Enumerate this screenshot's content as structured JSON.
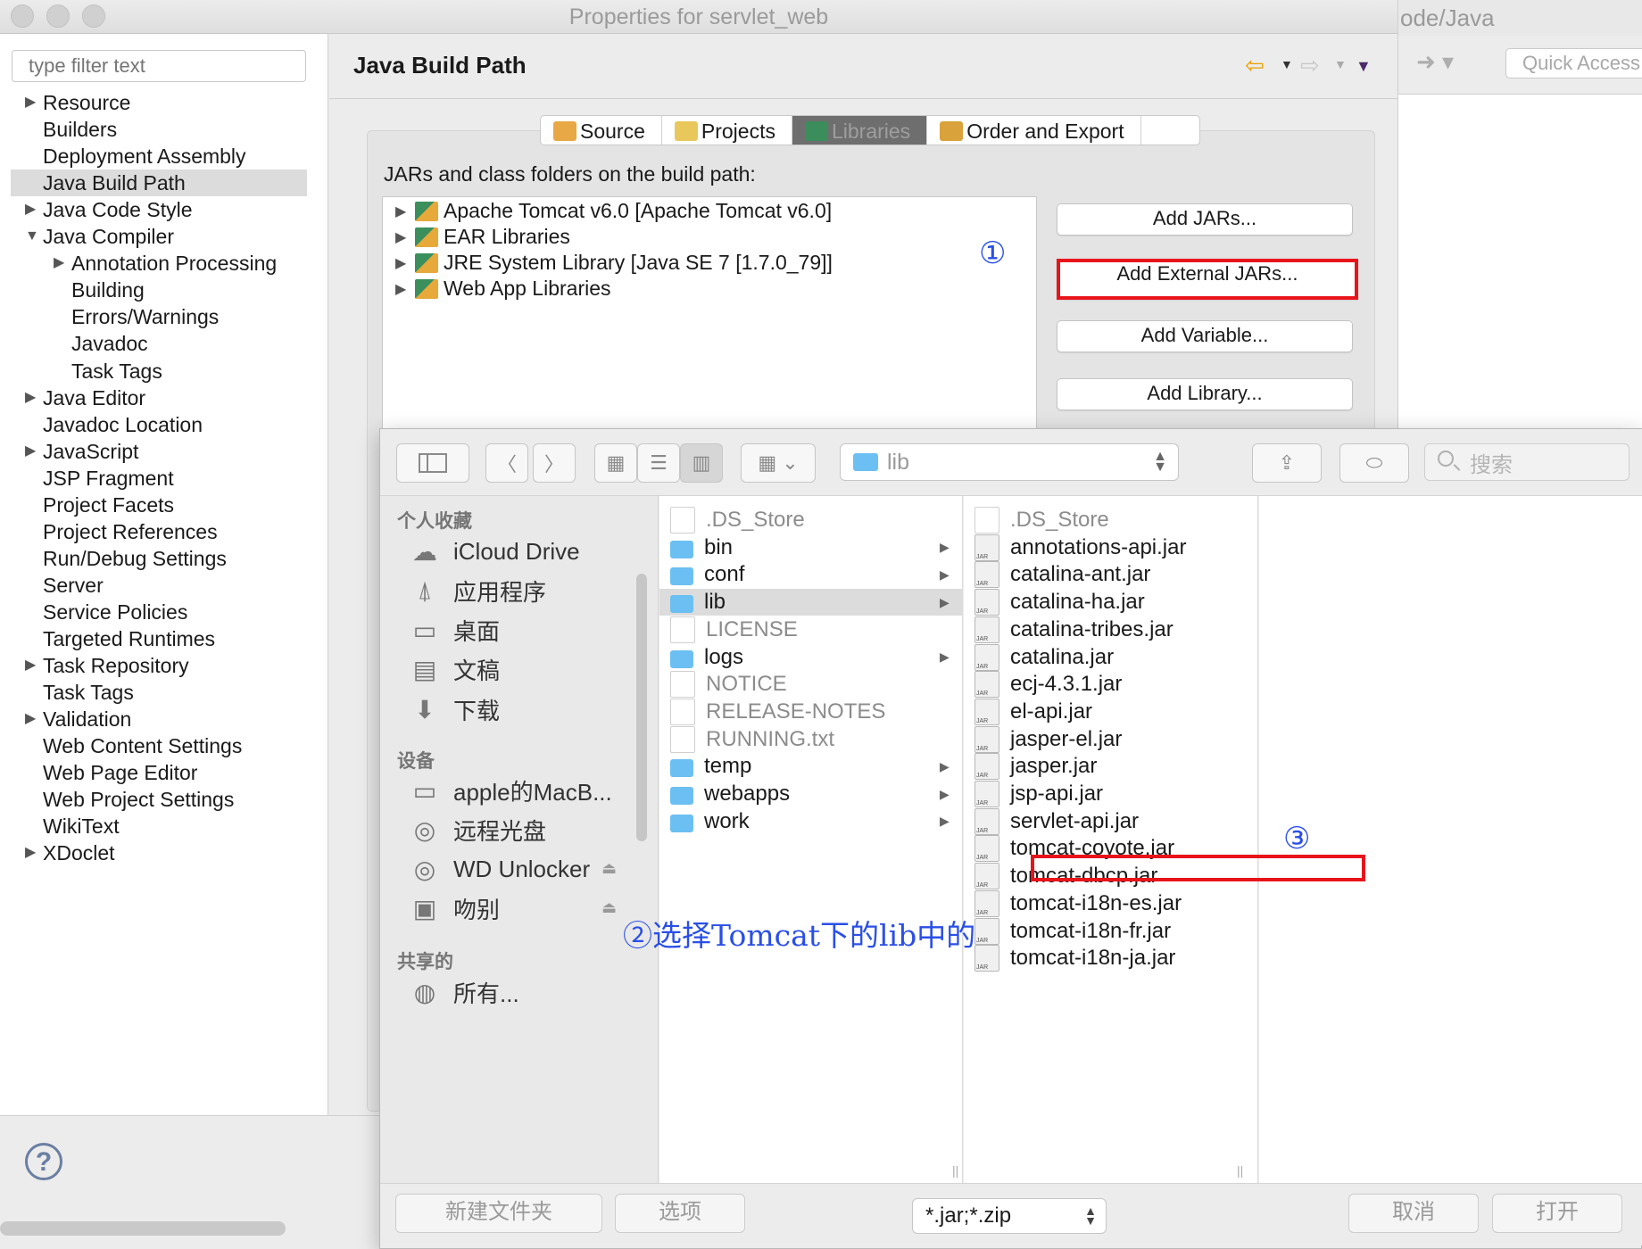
{
  "background_window": {
    "title_fragment": "ode/Java",
    "quick_access_placeholder": "Quick Access"
  },
  "window": {
    "title": "Properties for servlet_web"
  },
  "nav": {
    "filter_placeholder": "type filter text",
    "items": [
      {
        "label": "Resource",
        "expandable": true
      },
      {
        "label": "Builders"
      },
      {
        "label": "Deployment Assembly"
      },
      {
        "label": "Java Build Path",
        "selected": true
      },
      {
        "label": "Java Code Style",
        "expandable": true
      },
      {
        "label": "Java Compiler",
        "expanded": true
      },
      {
        "label": "Annotation Processing",
        "expandable": true,
        "indent": 1
      },
      {
        "label": "Building",
        "indent": 1
      },
      {
        "label": "Errors/Warnings",
        "indent": 1
      },
      {
        "label": "Javadoc",
        "indent": 1
      },
      {
        "label": "Task Tags",
        "indent": 1
      },
      {
        "label": "Java Editor",
        "expandable": true
      },
      {
        "label": "Javadoc Location"
      },
      {
        "label": "JavaScript",
        "expandable": true
      },
      {
        "label": "JSP Fragment"
      },
      {
        "label": "Project Facets"
      },
      {
        "label": "Project References"
      },
      {
        "label": "Run/Debug Settings"
      },
      {
        "label": "Server"
      },
      {
        "label": "Service Policies"
      },
      {
        "label": "Targeted Runtimes"
      },
      {
        "label": "Task Repository",
        "expandable": true
      },
      {
        "label": "Task Tags"
      },
      {
        "label": "Validation",
        "expandable": true
      },
      {
        "label": "Web Content Settings"
      },
      {
        "label": "Web Page Editor"
      },
      {
        "label": "Web Project Settings"
      },
      {
        "label": "WikiText"
      },
      {
        "label": "XDoclet",
        "expandable": true
      }
    ]
  },
  "page": {
    "title": "Java Build Path",
    "tabs": [
      {
        "label": "Source"
      },
      {
        "label": "Projects"
      },
      {
        "label": "Libraries",
        "active": true
      },
      {
        "label": "Order and Export"
      }
    ],
    "libs_label": "JARs and class folders on the build path:",
    "libraries": [
      "Apache Tomcat v6.0 [Apache Tomcat v6.0]",
      "EAR Libraries",
      "JRE System Library [Java SE 7 [1.7.0_79]]",
      "Web App Libraries"
    ],
    "buttons": {
      "add_jars": "Add JARs...",
      "add_external_jars": "Add External JARs...",
      "add_variable": "Add Variable...",
      "add_library": "Add Library..."
    }
  },
  "annotations": {
    "step1": "①",
    "step2": "②选择Tomcat下的lib中的",
    "step3": "③"
  },
  "file_dialog": {
    "path": "lib",
    "search_placeholder": "搜索",
    "sidebar": {
      "favorites_header": "个人收藏",
      "favorites": [
        {
          "label": "iCloud Drive",
          "icon": "cloud-icon"
        },
        {
          "label": "应用程序",
          "icon": "applications-icon"
        },
        {
          "label": "桌面",
          "icon": "desktop-icon"
        },
        {
          "label": "文稿",
          "icon": "documents-icon"
        },
        {
          "label": "下载",
          "icon": "downloads-icon"
        }
      ],
      "devices_header": "设备",
      "devices": [
        {
          "label": "apple的MacB...",
          "icon": "laptop-icon"
        },
        {
          "label": "远程光盘",
          "icon": "disc-icon"
        },
        {
          "label": "WD Unlocker",
          "icon": "disc-icon"
        },
        {
          "label": "吻别",
          "icon": "drive-icon"
        }
      ],
      "shared_header": "共享的",
      "shared": [
        {
          "label": "所有...",
          "icon": "network-icon"
        }
      ]
    },
    "column1": [
      {
        "name": ".DS_Store",
        "type": "file",
        "dim": true
      },
      {
        "name": "bin",
        "type": "folder"
      },
      {
        "name": "conf",
        "type": "folder"
      },
      {
        "name": "lib",
        "type": "folder",
        "selected": true
      },
      {
        "name": "LICENSE",
        "type": "file",
        "dim": true
      },
      {
        "name": "logs",
        "type": "folder"
      },
      {
        "name": "NOTICE",
        "type": "file",
        "dim": true
      },
      {
        "name": "RELEASE-NOTES",
        "type": "file",
        "dim": true
      },
      {
        "name": "RUNNING.txt",
        "type": "file",
        "dim": true
      },
      {
        "name": "temp",
        "type": "folder"
      },
      {
        "name": "webapps",
        "type": "folder"
      },
      {
        "name": "work",
        "type": "folder"
      }
    ],
    "column2": [
      {
        "name": ".DS_Store",
        "type": "file",
        "dim": true
      },
      {
        "name": "annotations-api.jar",
        "type": "jar"
      },
      {
        "name": "catalina-ant.jar",
        "type": "jar"
      },
      {
        "name": "catalina-ha.jar",
        "type": "jar"
      },
      {
        "name": "catalina-tribes.jar",
        "type": "jar"
      },
      {
        "name": "catalina.jar",
        "type": "jar"
      },
      {
        "name": "ecj-4.3.1.jar",
        "type": "jar"
      },
      {
        "name": "el-api.jar",
        "type": "jar"
      },
      {
        "name": "jasper-el.jar",
        "type": "jar"
      },
      {
        "name": "jasper.jar",
        "type": "jar"
      },
      {
        "name": "jsp-api.jar",
        "type": "jar"
      },
      {
        "name": "servlet-api.jar",
        "type": "jar",
        "highlighted": true
      },
      {
        "name": "tomcat-coyote.jar",
        "type": "jar"
      },
      {
        "name": "tomcat-dbcp.jar",
        "type": "jar"
      },
      {
        "name": "tomcat-i18n-es.jar",
        "type": "jar"
      },
      {
        "name": "tomcat-i18n-fr.jar",
        "type": "jar"
      },
      {
        "name": "tomcat-i18n-ja.jar",
        "type": "jar"
      }
    ],
    "file_type": "*.jar;*.zip",
    "buttons": {
      "new_folder": "新建文件夹",
      "options": "选项",
      "cancel": "取消",
      "open": "打开"
    }
  },
  "colors": {
    "highlight_red": "#e8141b",
    "annotation_blue": "#2a4fe6",
    "folder_blue": "#6bbff2"
  }
}
